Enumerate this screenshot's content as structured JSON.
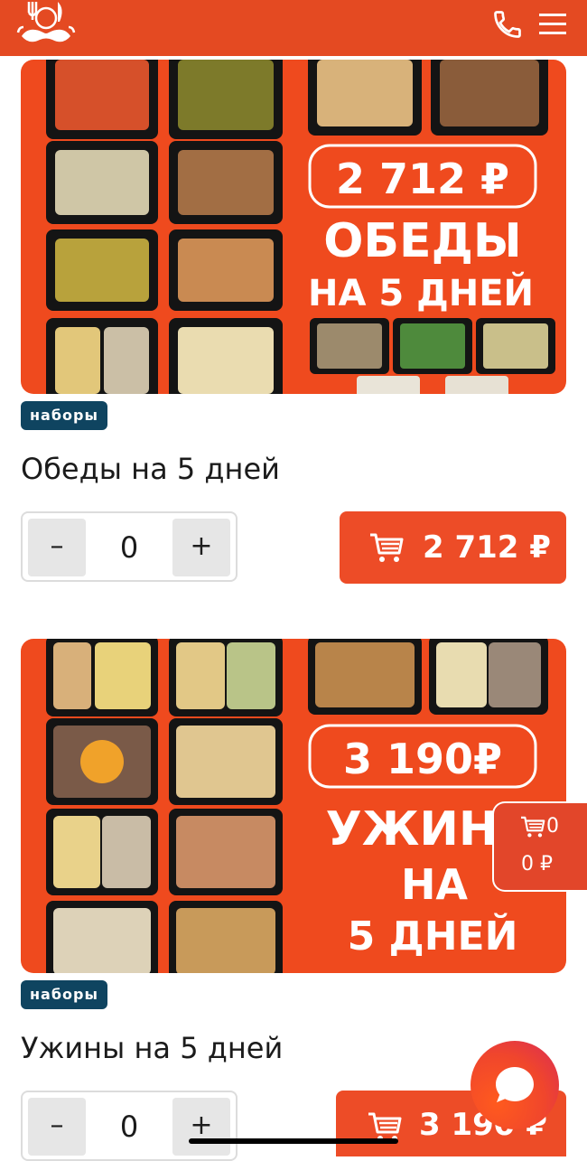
{
  "header": {
    "logo_icon": "chef-moustache-logo-icon",
    "phone_icon": "phone-icon",
    "menu_icon": "hamburger-menu-icon",
    "brand_color": "#e44a22"
  },
  "products": [
    {
      "promo_price": "2 712 ₽",
      "promo_line1": "ОБЕДЫ",
      "promo_line2": "НА 5 ДНЕЙ",
      "tag": "наборы",
      "title": "Обеды на 5 дней",
      "quantity": "0",
      "minus_label": "–",
      "plus_label": "+",
      "price": "2 712 ₽"
    },
    {
      "promo_price": "3 190₽",
      "promo_line1": "УЖИНЫ",
      "promo_line2": "НА",
      "promo_line3": "5 ДНЕЙ",
      "tag": "наборы",
      "title": "Ужины на 5 дней",
      "quantity": "0",
      "minus_label": "–",
      "plus_label": "+",
      "price": "3 190 ₽"
    }
  ],
  "floating_cart": {
    "count": "0",
    "sum": "0 ₽"
  },
  "chat_icon": "chat-bubble-icon",
  "colors": {
    "accent": "#ed4c27",
    "tag_bg": "#0f4460",
    "promo_bg": "#ef4a1e"
  }
}
